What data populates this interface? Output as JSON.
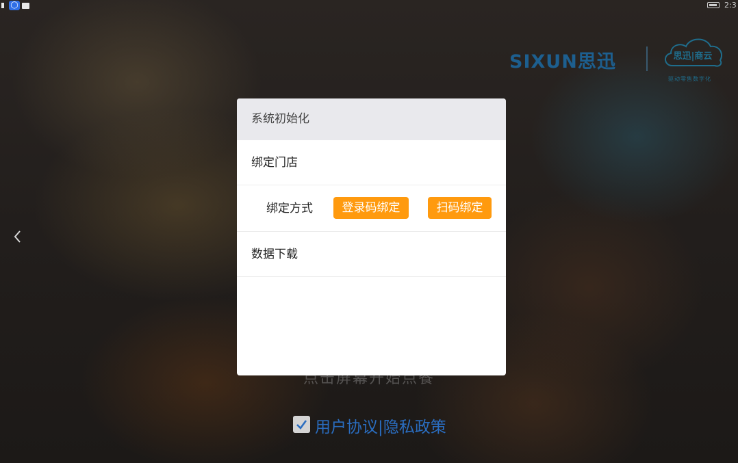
{
  "status_bar": {
    "time": "2:3",
    "app_icon": "notification-app-icon",
    "battery_icon": "battery-icon"
  },
  "brand": {
    "name": "SIXUN思迅",
    "cloud_text": "思迅|商云",
    "cloud_subtitle": "驱动零售数字化",
    "color": "#1d5f8f"
  },
  "dialog": {
    "title": "系统初始化",
    "bind_store_label": "绑定门店",
    "bind_method_label": "绑定方式",
    "login_code_bind_button": "登录码绑定",
    "scan_bind_button": "扫码绑定",
    "data_download_label": "数据下载",
    "accent_color": "#ff9a0e"
  },
  "background": {
    "start_hint": "点击屏幕开始点餐",
    "agreement_text": "用户协议|隐私政策",
    "agreement_checked": true
  }
}
